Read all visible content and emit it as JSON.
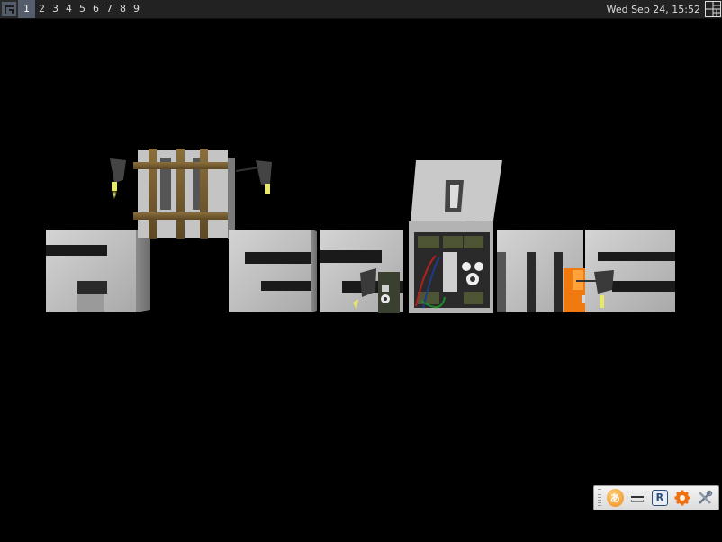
{
  "topbar": {
    "launcher_icon": "awesome-launcher-icon",
    "tags": [
      "1",
      "2",
      "3",
      "4",
      "5",
      "6",
      "7",
      "8",
      "9"
    ],
    "active_tag": "1",
    "clock": "Wed Sep 24, 15:52",
    "layout_icon": "tile-layout-icon"
  },
  "systray": {
    "icons": [
      "ime-icon",
      "keyboard-icon",
      "r-app-icon",
      "settings-gear-icon",
      "tools-icon"
    ],
    "ime_label": "あ",
    "r_label": "R"
  },
  "colors": {
    "bar_bg": "#222222",
    "active_tag_bg": "#535d6c",
    "text": "#dddddd",
    "desktop_bg": "#000000"
  }
}
